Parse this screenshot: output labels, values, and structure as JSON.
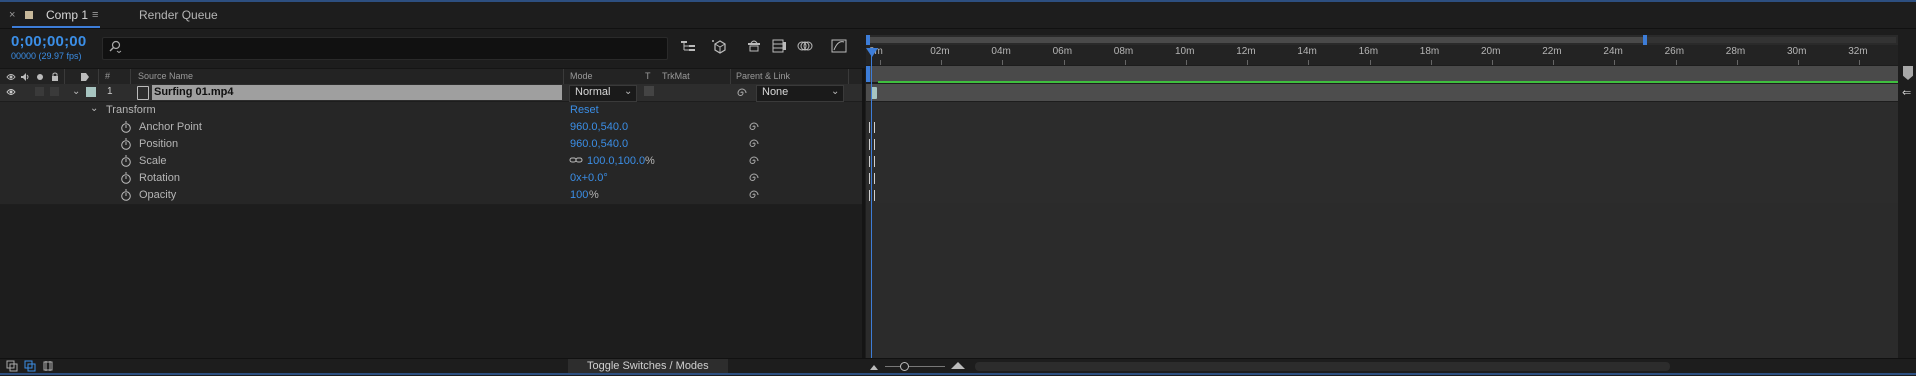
{
  "tabs": [
    {
      "label": "Comp 1",
      "close": "×",
      "menu": "≡"
    },
    {
      "label": "Render Queue"
    }
  ],
  "timecode": "0;00;00;00",
  "frames_fps": "00000 (29.97 fps)",
  "search": {
    "placeholder": ""
  },
  "columns": {
    "number": "#",
    "source_name": "Source Name",
    "mode": "Mode",
    "t": "T",
    "trkmat": "TrkMat",
    "parent_link": "Parent & Link"
  },
  "layer": {
    "number": "1",
    "name": "Surfing 01.mp4",
    "mode": "Normal",
    "parent": "None"
  },
  "transform": {
    "label": "Transform",
    "reset": "Reset",
    "props": [
      {
        "label": "Anchor Point",
        "value": "960.0,540.0",
        "unit": ""
      },
      {
        "label": "Position",
        "value": "960.0,540.0",
        "unit": ""
      },
      {
        "label": "Scale",
        "value": "100.0,100.0",
        "unit": "%"
      },
      {
        "label": "Rotation",
        "value": "0x+0.0°",
        "unit": ""
      },
      {
        "label": "Opacity",
        "value": "100",
        "unit": "%"
      }
    ]
  },
  "ruler": {
    "labels": [
      "0m",
      "02m",
      "04m",
      "06m",
      "08m",
      "10m",
      "12m",
      "14m",
      "16m",
      "18m",
      "20m",
      "22m",
      "24m",
      "26m",
      "28m",
      "30m",
      "32m"
    ]
  },
  "bottom": {
    "toggle_label": "Toggle Switches / Modes"
  },
  "colors": {
    "accent": "#3b8ee6",
    "layer_label": "#a7c5c1",
    "layer_bar_green": "#3fbf3f"
  }
}
